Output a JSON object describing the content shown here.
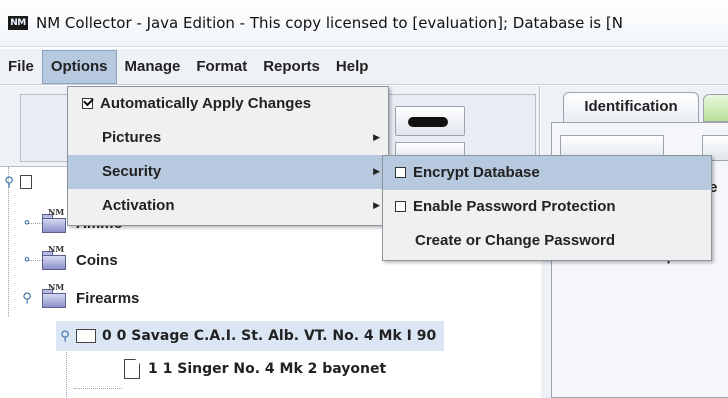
{
  "window": {
    "icon_text": "NM",
    "title": "NM Collector - Java Edition - This copy licensed to [evaluation];  Database is [N"
  },
  "menubar": {
    "items": [
      "File",
      "Options",
      "Manage",
      "Format",
      "Reports",
      "Help"
    ],
    "active": "Options"
  },
  "options_menu": {
    "items": [
      {
        "label": "Automatically Apply Changes",
        "checked": true
      },
      {
        "label": "Pictures",
        "submenu": true
      },
      {
        "label": "Security",
        "submenu": true,
        "highlighted": true
      },
      {
        "label": "Activation",
        "submenu": true
      }
    ]
  },
  "security_menu": {
    "items": [
      {
        "label": "Encrypt Database",
        "checkbox": true,
        "checked": false,
        "highlighted": true
      },
      {
        "label": "Enable Password Protection",
        "checkbox": true,
        "checked": false
      },
      {
        "label": "Create or Change Password",
        "checkbox": false
      }
    ]
  },
  "tree": {
    "icon_label": "NM",
    "items": [
      {
        "label": "Ammo"
      },
      {
        "label": "Coins"
      },
      {
        "label": "Firearms"
      },
      {
        "label": "0 0 Savage C.A.I. St. Alb. VT. No. 4 Mk I 90"
      },
      {
        "label": "1 1 Singer No. 4 Mk 2 bayonet"
      }
    ]
  },
  "right_panel": {
    "tab_identification": "Identification",
    "fragment_1": "de",
    "fragment_2": "Eult Captio"
  },
  "colors": {
    "menu_highlight": "#b7c9de",
    "tree_handle": "#3b6ea5",
    "folder_icon": "#8d92c9"
  }
}
